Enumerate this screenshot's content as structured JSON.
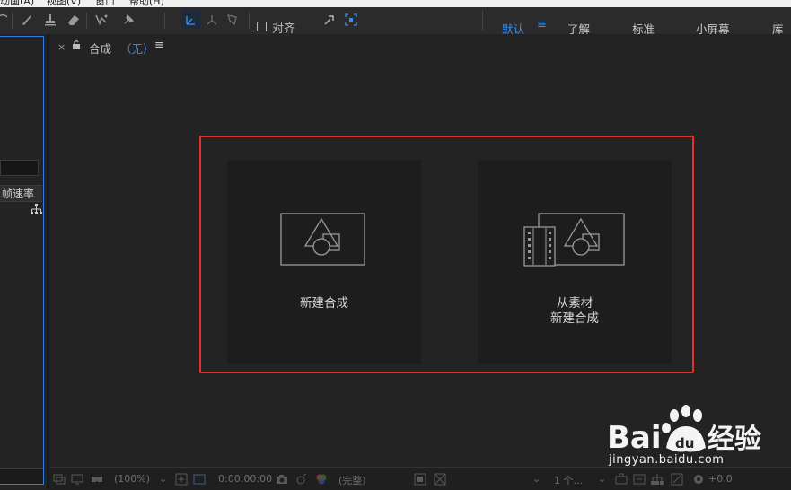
{
  "menubar": {
    "items": [
      "动画(A)",
      "视图(V)",
      "窗口",
      "帮助(H)"
    ]
  },
  "toolbar": {
    "snap_label": "对齐",
    "workspaces": [
      {
        "label": "默认",
        "active": true
      },
      {
        "label": "了解",
        "active": false
      },
      {
        "label": "标准",
        "active": false
      },
      {
        "label": "小屏幕",
        "active": false
      },
      {
        "label": "库",
        "active": false
      }
    ],
    "workspace_menu_icon": "hamburger-icon"
  },
  "project_panel": {
    "column_header": "帧速率"
  },
  "composition_panel": {
    "tab_close": "×",
    "tab_title": "合成",
    "tab_subtitle": "（无）",
    "tab_menu": "≡",
    "cards": [
      {
        "lines": [
          "新建合成"
        ],
        "icon": "composition-icon"
      },
      {
        "lines": [
          "从素材",
          "新建合成"
        ],
        "icon": "footage-composition-icon"
      }
    ],
    "highlight_color": "#e0312a"
  },
  "viewer_bar": {
    "zoom": "(100%)",
    "timecode": "0:00:00:00",
    "resolution": "(完整)",
    "view_count": "1 个...",
    "exposure": "+0.0"
  },
  "watermark": {
    "brand_left": "Bai",
    "brand_right": "经验",
    "url": "jingyan.baidu.com"
  },
  "colors": {
    "accent": "#3d8fe8",
    "panel_bg": "#232323",
    "card_bg": "#1d1d1d"
  }
}
